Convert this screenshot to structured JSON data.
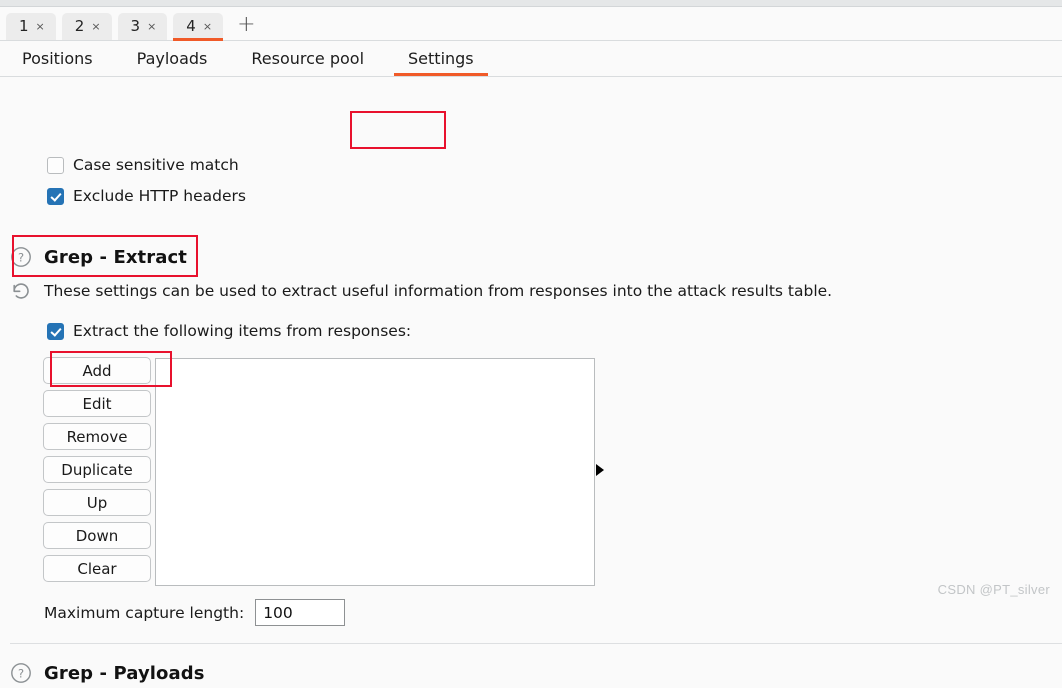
{
  "window": {
    "accent_orange": "#f05a28",
    "annotation_red": "#e8112d",
    "checkbox_blue": "#2573b5"
  },
  "attack_tabs": {
    "items": [
      {
        "label": "1",
        "close": "×",
        "active": false
      },
      {
        "label": "2",
        "close": "×",
        "active": false
      },
      {
        "label": "3",
        "close": "×",
        "active": false
      },
      {
        "label": "4",
        "close": "×",
        "active": true
      }
    ],
    "add_label": "+"
  },
  "section_tabs": {
    "items": [
      {
        "label": "Positions",
        "active": false
      },
      {
        "label": "Payloads",
        "active": false
      },
      {
        "label": "Resource pool",
        "active": false
      },
      {
        "label": "Settings",
        "active": true
      }
    ]
  },
  "grep_match_options": {
    "case_sensitive": {
      "label": "Case sensitive match",
      "checked": false
    },
    "exclude_headers": {
      "label": "Exclude HTTP headers",
      "checked": true
    }
  },
  "grep_extract": {
    "help_icon": "question-mark-circle",
    "reset_icon": "reset-arrow",
    "title": "Grep - Extract",
    "description": "These settings can be used to extract useful information from responses into the attack results table.",
    "enable_checkbox": {
      "label": "Extract the following items from responses:",
      "checked": true
    },
    "buttons": [
      "Add",
      "Edit",
      "Remove",
      "Duplicate",
      "Up",
      "Down",
      "Clear"
    ],
    "list_items": [],
    "splitter_icon": "triangle-right-icon",
    "max_capture": {
      "label": "Maximum capture length:",
      "value": "100",
      "placeholder": ""
    }
  },
  "grep_payloads": {
    "help_icon": "question-mark-circle",
    "title": "Grep - Payloads"
  },
  "watermark": {
    "text": "CSDN @PT_silver"
  }
}
